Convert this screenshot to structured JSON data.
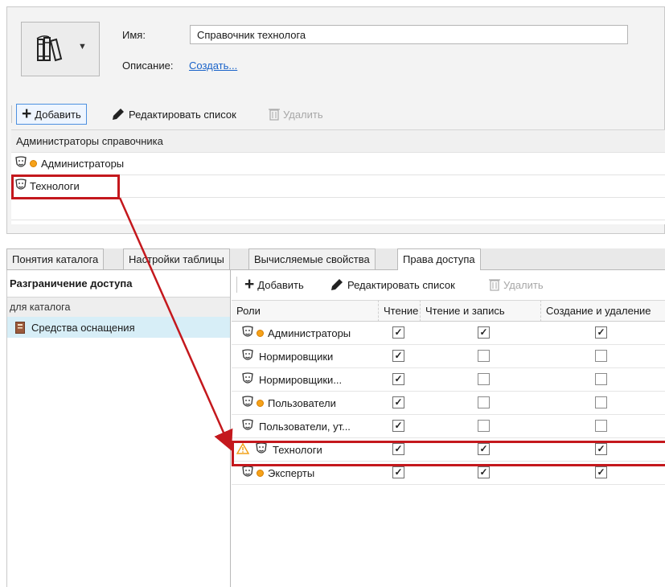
{
  "header": {
    "name_label": "Имя:",
    "name_value": "Справочник технолога",
    "description_label": "Описание:",
    "description_link": "Создать..."
  },
  "top_toolbar": {
    "add": "Добавить",
    "edit": "Редактировать список",
    "delete": "Удалить"
  },
  "directory_admins": {
    "header": "Администраторы справочника",
    "items": [
      {
        "label": "Администраторы",
        "icon": "mask-icon",
        "badge": "group-dot-icon"
      },
      {
        "label": "Технологи",
        "icon": "mask-icon",
        "highlighted": true
      }
    ]
  },
  "tabs": [
    {
      "label": "Понятия каталога",
      "active": false
    },
    {
      "label": "Настройки таблицы",
      "active": false
    },
    {
      "label": "Вычисляемые свойства",
      "active": false
    },
    {
      "label": "Права доступа",
      "active": true
    }
  ],
  "left_panel": {
    "title": "Разграничение доступа",
    "group": "для каталога",
    "item": "Средства оснащения"
  },
  "bottom_toolbar": {
    "add": "Добавить",
    "edit": "Редактировать список",
    "delete": "Удалить"
  },
  "permissions": {
    "columns": [
      "Роли",
      "Чтение",
      "Чтение и запись",
      "Создание и удаление"
    ],
    "rows": [
      {
        "role": "Администраторы",
        "group": true,
        "warning": false,
        "read": true,
        "write": true,
        "create": true
      },
      {
        "role": "Нормировщики",
        "group": false,
        "warning": false,
        "read": true,
        "write": false,
        "create": false
      },
      {
        "role": "Нормировщики...",
        "group": false,
        "warning": false,
        "read": true,
        "write": false,
        "create": false
      },
      {
        "role": "Пользователи",
        "group": true,
        "warning": false,
        "read": true,
        "write": false,
        "create": false
      },
      {
        "role": "Пользователи, ут...",
        "group": false,
        "warning": false,
        "read": true,
        "write": false,
        "create": false
      },
      {
        "role": "Технологи",
        "group": false,
        "warning": true,
        "read": true,
        "write": true,
        "create": true,
        "highlighted": true
      },
      {
        "role": "Эксперты",
        "group": true,
        "warning": false,
        "read": true,
        "write": true,
        "create": true
      }
    ]
  },
  "colors": {
    "annotation": "#c4181d",
    "link": "#1a63c9",
    "selection": "#d7eef7",
    "warning": "#f2a21b"
  }
}
